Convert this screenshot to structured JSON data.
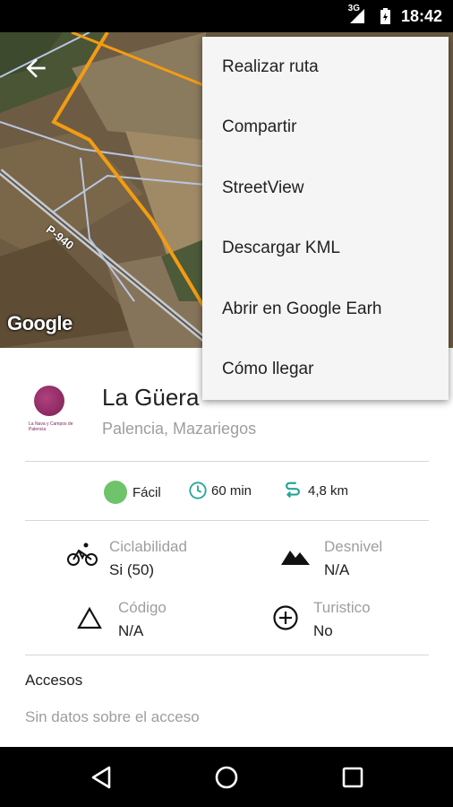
{
  "status_bar": {
    "network": "3G",
    "time": "18:42"
  },
  "map": {
    "attribution": "Google",
    "road_label": "P-940"
  },
  "menu": {
    "items": [
      {
        "label": "Realizar ruta"
      },
      {
        "label": "Compartir"
      },
      {
        "label": "StreetView"
      },
      {
        "label": "Descargar KML"
      },
      {
        "label": "Abrir en Google Earh"
      },
      {
        "label": "Cómo llegar"
      }
    ]
  },
  "place": {
    "title": "La Güera",
    "subtitle": "Palencia, Mazariegos",
    "logo_text": "La Nava y Campos de Palencia"
  },
  "stats": {
    "difficulty": "Fácil",
    "difficulty_color": "#6fc36b",
    "duration": "60 min",
    "distance": "4,8 km"
  },
  "attributes": {
    "ciclabilidad": {
      "label": "Ciclabilidad",
      "value": "Si (50)"
    },
    "desnivel": {
      "label": "Desnivel",
      "value": "N/A"
    },
    "codigo": {
      "label": "Código",
      "value": "N/A"
    },
    "turistico": {
      "label": "Turistico",
      "value": "No"
    }
  },
  "accesos": {
    "title": "Accesos",
    "text": "Sin datos sobre el acceso"
  },
  "colors": {
    "accent_teal": "#26a69a",
    "route_orange": "#f39c12",
    "menu_bg": "#f5f5f5"
  }
}
